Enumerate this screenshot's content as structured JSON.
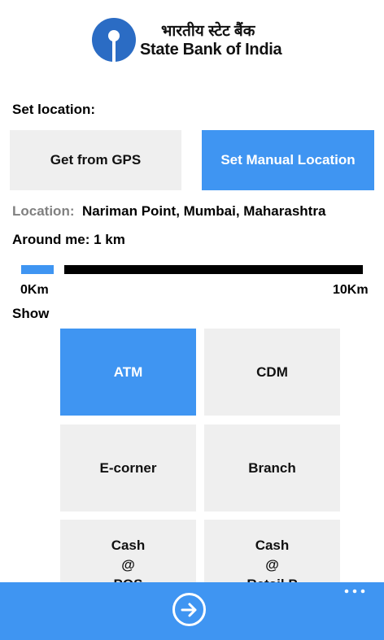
{
  "header": {
    "hindi_name": "भारतीय स्टेट बैंक",
    "bank_name": "State Bank of India"
  },
  "set_location": {
    "title": "Set location:",
    "gps_button": "Get from GPS",
    "manual_button": "Set Manual Location"
  },
  "location": {
    "label": "Location:",
    "value": "Nariman Point, Mumbai, Maharashtra"
  },
  "range": {
    "label": "Around me: 1 km",
    "min_label": "0Km",
    "max_label": "10Km",
    "value_km": 1,
    "max_km": 10
  },
  "show": {
    "title": "Show",
    "options": {
      "atm": "ATM",
      "cdm": "CDM",
      "ecorner": "E-corner",
      "branch": "Branch",
      "cash_pos": [
        "Cash",
        "@",
        "POS"
      ],
      "cash_retail": [
        "Cash",
        "@",
        "Retail P"
      ]
    },
    "selected": "ATM"
  },
  "colors": {
    "accent": "#3f95f2",
    "tile": "#efefef"
  },
  "appbar": {
    "go_icon": "arrow-right-circle-icon",
    "more_icon": "ellipsis-icon"
  }
}
